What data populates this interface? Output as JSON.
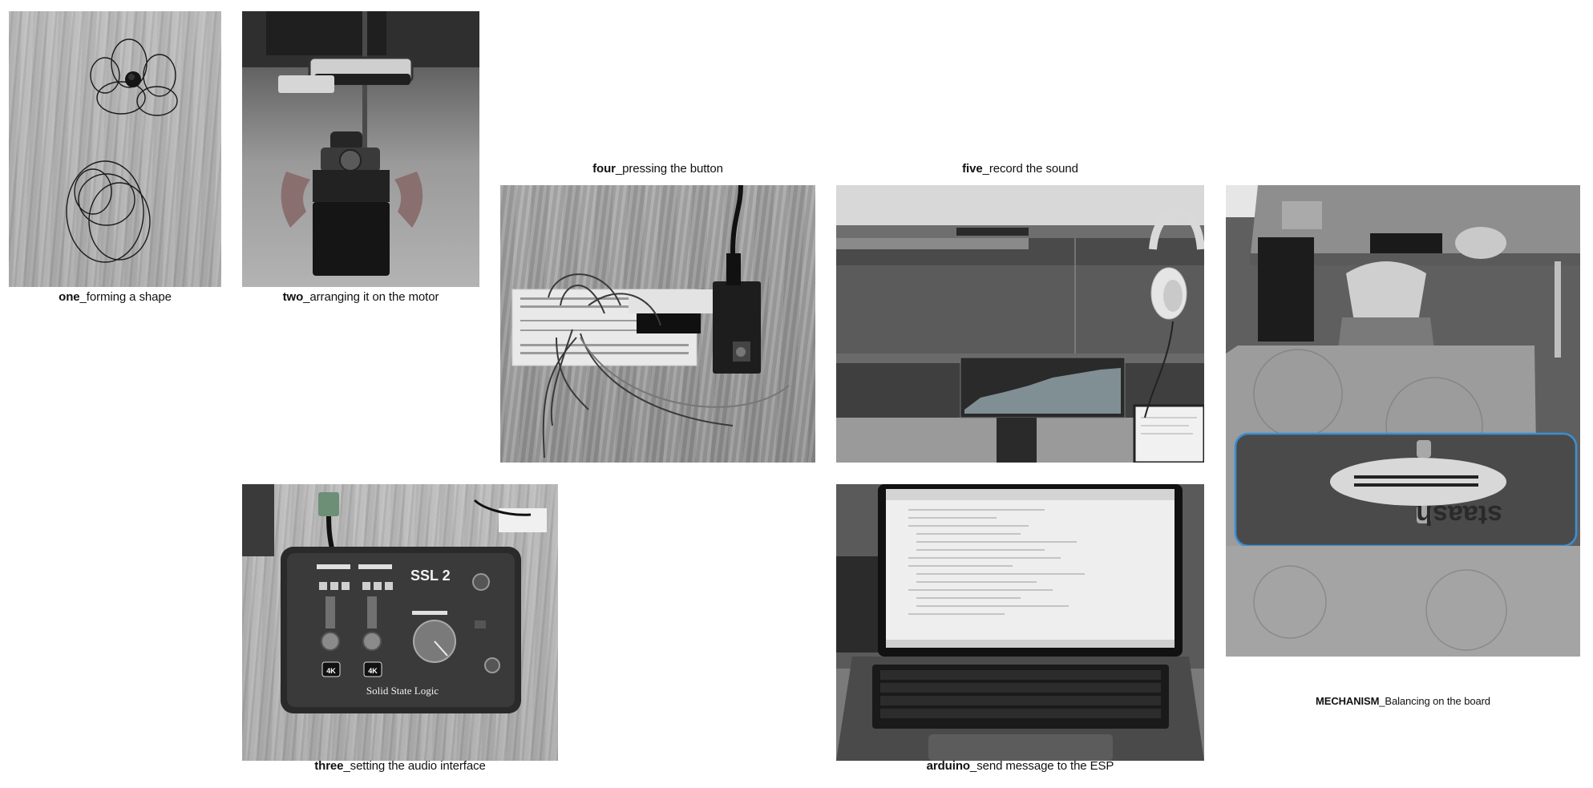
{
  "panels": {
    "one": {
      "bold": "one",
      "text": "_forming a shape"
    },
    "two": {
      "bold": "two",
      "text": "_arranging it on the motor"
    },
    "three": {
      "bold": "three",
      "text": "_setting the audio interface"
    },
    "four": {
      "bold": "four",
      "text": "_pressing the button"
    },
    "five": {
      "bold": "five",
      "text": "_record the sound"
    },
    "arduino": {
      "bold": "arduino",
      "text": "_send message to the ESP"
    },
    "mechanism": {
      "bold": "MECHANISM",
      "text": "_Balancing on the board"
    }
  },
  "photo_text": {
    "ssl_logo": "SSL 2",
    "ssl_brand": "Solid State Logic",
    "ssl_4k": "4K",
    "mat_brand": "staash"
  }
}
